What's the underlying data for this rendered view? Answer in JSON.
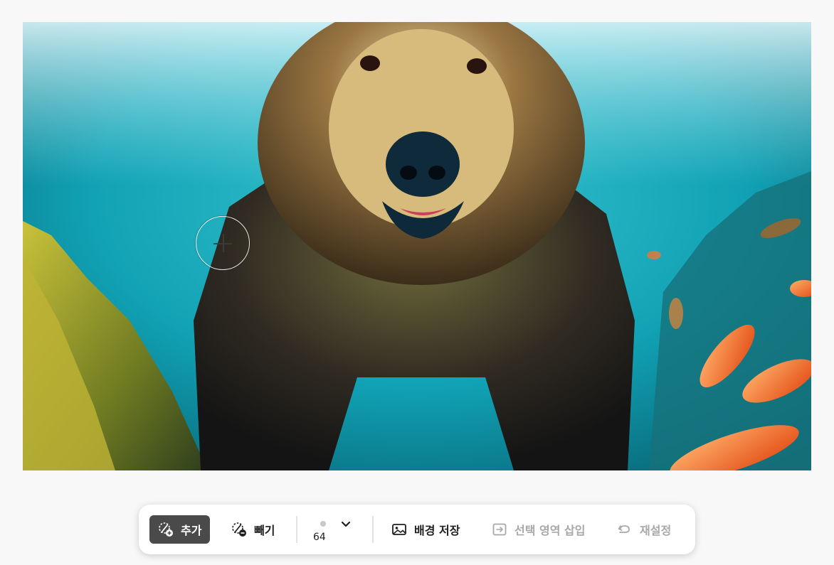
{
  "canvas": {
    "image_alt": "Grizzly bear swimming underwater with orange fish",
    "brush_cursor": "crosshair-brush-cursor"
  },
  "toolbar": {
    "add_label": "추가",
    "add_icon": "brush-add-icon",
    "subtract_label": "빼기",
    "subtract_icon": "brush-subtract-icon",
    "brush_size_value": "64",
    "brush_size_icon": "brush-dot-icon",
    "brush_chevron_icon": "chevron-down-icon",
    "save_background_label": "배경 저장",
    "save_background_icon": "image-icon",
    "insert_selection_label": "선택 영역 삽입",
    "insert_selection_icon": "insert-selection-icon",
    "reset_label": "재설정",
    "reset_icon": "undo-icon"
  },
  "colors": {
    "active_button": "#4a4a4a",
    "disabled_text": "#a8a8a8",
    "page_background": "#f8f8f8"
  }
}
